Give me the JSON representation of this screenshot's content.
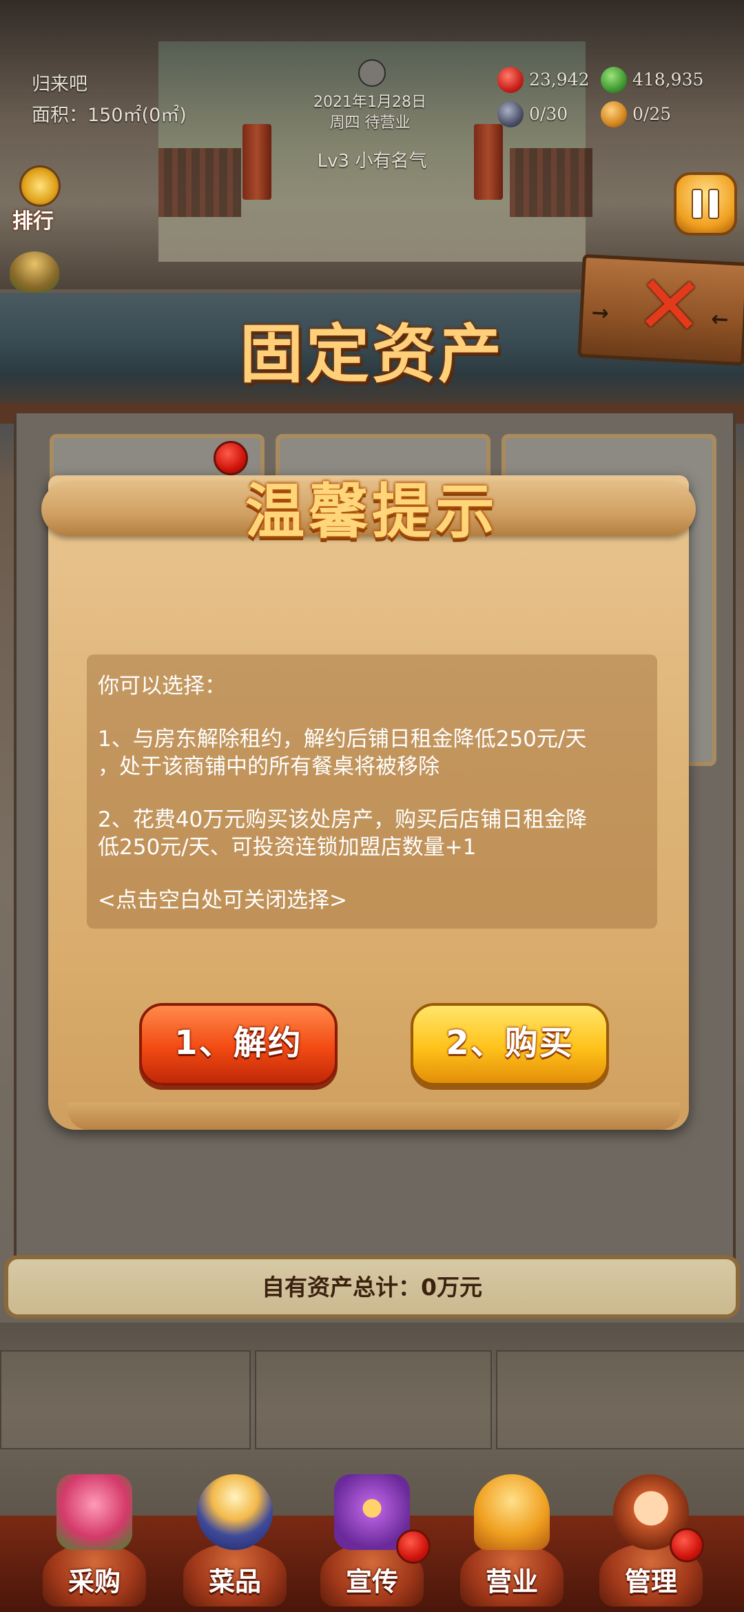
{
  "hud": {
    "shop_name": "归来吧",
    "area": "面积：150㎡(0㎡)",
    "date": "2021年1月28日",
    "weekday_status": "周四 待营业",
    "level": "Lv3 小有名气",
    "hearts": "23,942",
    "money": "418,935",
    "tables": "0/30",
    "staff": "0/25",
    "rank_label": "排行"
  },
  "panel": {
    "title": "固定资产",
    "total_assets": "自有资产总计：0万元"
  },
  "dialog": {
    "title": "温馨提示",
    "lines": [
      "你可以选择：",
      "1、与房东解除租约，解约后铺日租金降低250元/天",
      "，处于该商铺中的所有餐桌将被移除",
      "2、花费40万元购买该处房产，购买后店铺日租金降",
      "低250元/天、可投资连锁加盟店数量+1",
      "<点击空白处可关闭选择>"
    ],
    "option1": "1、解约",
    "option2": "2、购买"
  },
  "nav": [
    {
      "label": "采购",
      "icon": "shop-stall-icon"
    },
    {
      "label": "菜品",
      "icon": "dish-bowl-icon"
    },
    {
      "label": "宣传",
      "icon": "video-play-icon"
    },
    {
      "label": "营业",
      "icon": "service-bell-icon"
    },
    {
      "label": "管理",
      "icon": "staff-avatar-icon"
    }
  ],
  "colors": {
    "accent_orange": "#f24a12",
    "accent_yellow": "#ffc21a",
    "scroll_paper": "#dfb57a"
  }
}
